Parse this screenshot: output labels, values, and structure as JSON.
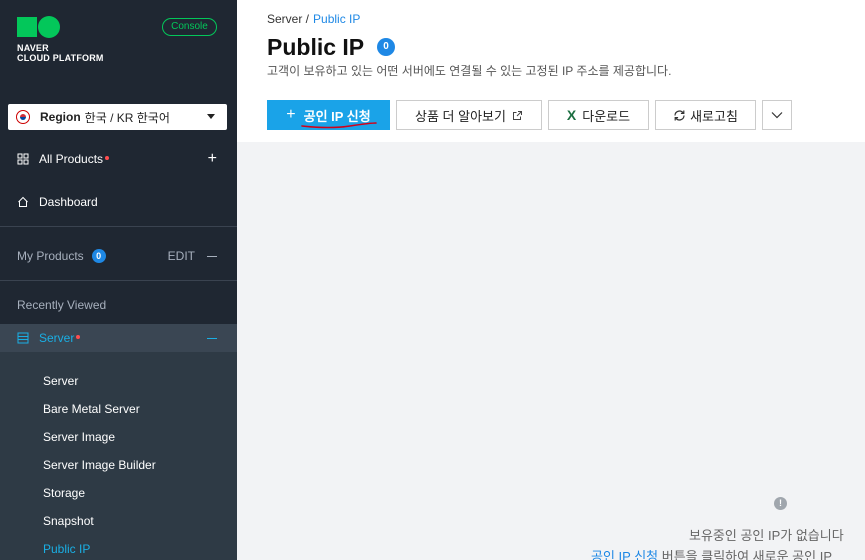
{
  "sidebar": {
    "logo_line1": "NAVER",
    "logo_line2": "CLOUD PLATFORM",
    "console_badge": "Console",
    "region": {
      "label": "Region",
      "value": "한국 / KR 한국어"
    },
    "all_products": "All Products",
    "dashboard": "Dashboard",
    "my_products": {
      "label": "My Products",
      "count": "0",
      "edit": "EDIT"
    },
    "recently_viewed": "Recently Viewed",
    "server_group": "Server",
    "server_items": [
      "Server",
      "Bare Metal Server",
      "Server Image",
      "Server Image Builder",
      "Storage",
      "Snapshot",
      "Public IP"
    ]
  },
  "main": {
    "breadcrumb": {
      "parent": "Server /",
      "current": "Public IP"
    },
    "title": "Public IP",
    "title_count": "0",
    "subtitle": "고객이 보유하고 있는 어떤 서버에도 연결될 수 있는 고정된 IP 주소를 제공합니다.",
    "toolbar": {
      "apply_label": "공인 IP 신청",
      "learn_more_label": "상품 더 알아보기",
      "download_label": "다운로드",
      "refresh_label": "새로고침"
    },
    "empty_state": {
      "info_glyph": "!",
      "message": "보유중인 공인 IP가 없습니다",
      "hint_link": "공인 IP 신청",
      "hint_rest": " 버튼을 클릭하여 새로운 공인 IP"
    }
  },
  "colors": {
    "sidebar_bg": "#1f2732",
    "brand_green": "#03c75a",
    "accent_blue": "#1aa3e8",
    "active_blue": "#1aafe4",
    "annotation_red": "#d0021b"
  }
}
